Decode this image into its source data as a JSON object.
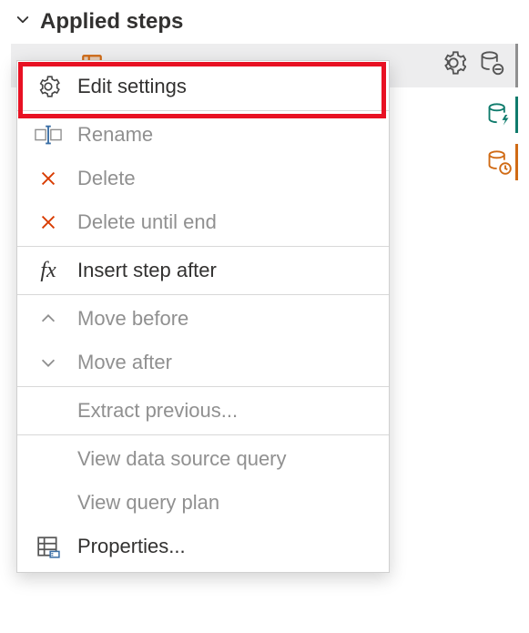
{
  "header": {
    "title": "Applied steps"
  },
  "menu": {
    "edit_settings": "Edit settings",
    "rename": "Rename",
    "delete": "Delete",
    "delete_until_end": "Delete until end",
    "insert_step_after": "Insert step after",
    "move_before": "Move before",
    "move_after": "Move after",
    "extract_previous": "Extract previous...",
    "view_data_source_query": "View data source query",
    "view_query_plan": "View query plan",
    "properties": "Properties..."
  }
}
